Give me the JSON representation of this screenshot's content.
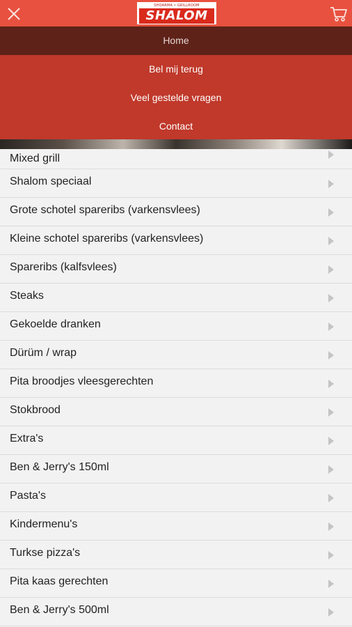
{
  "header": {
    "logo": {
      "tagline": "SHOARMA • GRILLROOM",
      "name": "SHALOM"
    },
    "close_icon": "close-icon",
    "cart_icon": "cart-icon",
    "colors": {
      "header_bg": "#e8513f",
      "menu_bg": "#c0392b",
      "menu_active_bg": "#5e2219"
    }
  },
  "menu": {
    "items": [
      {
        "label": "Home",
        "active": true
      },
      {
        "label": "Bel mij terug"
      },
      {
        "label": "Veel gestelde vragen"
      },
      {
        "label": "Contact"
      }
    ]
  },
  "categories": [
    "Mixed grill",
    "Shalom speciaal",
    "Grote schotel spareribs (varkensvlees)",
    "Kleine schotel spareribs (varkensvlees)",
    "Spareribs (kalfsvlees)",
    "Steaks",
    "Gekoelde dranken",
    "Dürüm / wrap",
    "Pita broodjes vleesgerechten",
    "Stokbrood",
    "Extra's",
    "Ben & Jerry's 150ml",
    "Pasta's",
    "Kindermenu's",
    "Turkse pizza's",
    "Pita kaas gerechten",
    "Ben & Jerry's 500ml"
  ]
}
